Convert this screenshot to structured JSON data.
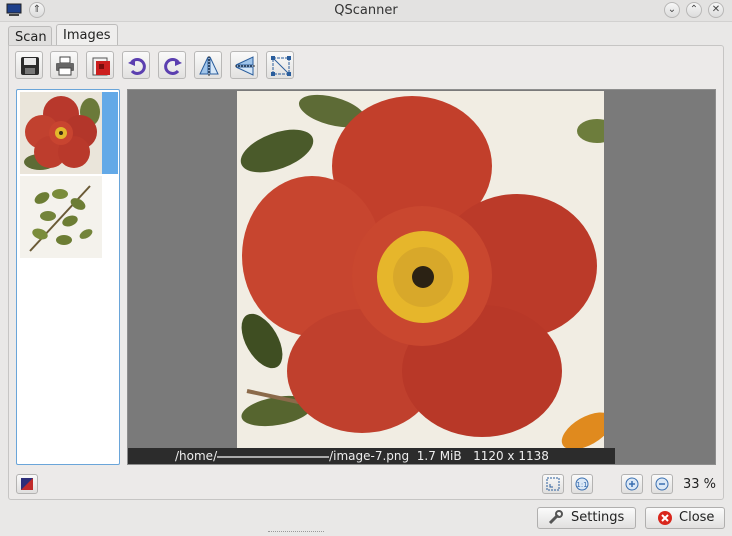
{
  "window": {
    "title": "QScanner"
  },
  "tabs": [
    {
      "label": "Scan"
    },
    {
      "label": "Images"
    }
  ],
  "toolbar": {
    "tools": [
      "save-icon",
      "print-icon",
      "pdf-icon",
      "rotate-left-icon",
      "rotate-right-icon",
      "flip-horizontal-icon",
      "flip-vertical-icon",
      "crop-icon"
    ]
  },
  "thumbnails": [
    "red-rose",
    "green-leaves"
  ],
  "image_info": {
    "path_start": "/home/",
    "path_end": "/image-7.png",
    "size": "1.7 MiB",
    "dimensions": "1120 x 1138"
  },
  "zoom": {
    "level": "33 %"
  },
  "buttons": {
    "settings": "Settings",
    "close": "Close"
  },
  "colors": {
    "accent": "#63a9e7",
    "close_red": "#d9261c",
    "petal": "#c43f2c"
  }
}
